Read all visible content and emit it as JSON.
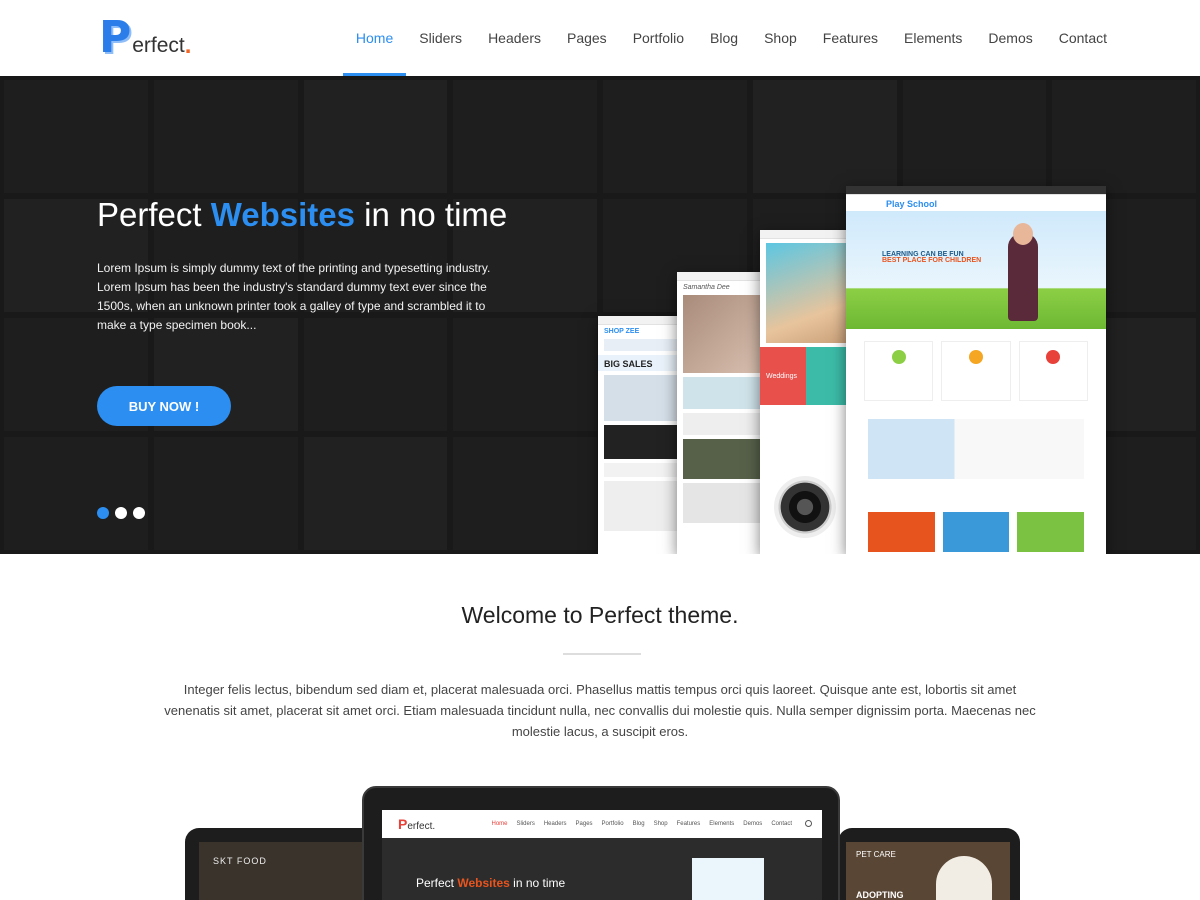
{
  "brand": {
    "logo_letter": "P",
    "logo_rest": "erfect",
    "logo_dot": ".",
    "accent_color": "#2b8ef0"
  },
  "nav": {
    "items": [
      {
        "label": "Home",
        "active": true
      },
      {
        "label": "Sliders"
      },
      {
        "label": "Headers"
      },
      {
        "label": "Pages"
      },
      {
        "label": "Portfolio"
      },
      {
        "label": "Blog"
      },
      {
        "label": "Shop"
      },
      {
        "label": "Features"
      },
      {
        "label": "Elements"
      },
      {
        "label": "Demos"
      },
      {
        "label": "Contact"
      }
    ]
  },
  "hero": {
    "title_before": "Perfect ",
    "title_accent": "Websites",
    "title_after": " in no time",
    "text": "Lorem Ipsum is simply dummy text of the printing and typesetting industry. Lorem Ipsum has been the industry's standard dummy text ever since the 1500s, when an unknown printer took a galley of type and scrambled it to make a type specimen book...",
    "button_label": "BUY NOW !",
    "slide_count": 3,
    "active_slide": 1,
    "mockups": {
      "shop_title": "BIG SALES",
      "shop_sub": "SHOP ZEE",
      "blog_title": "Samantha Dee",
      "photo_title": "Weddings",
      "school_title": "Play School",
      "school_headline": "LEARNING CAN BE FUN",
      "school_sub": "BEST PLACE FOR CHILDREN"
    }
  },
  "welcome": {
    "title": "Welcome to Perfect theme.",
    "text": "Integer felis lectus, bibendum sed diam et, placerat malesuada orci. Phasellus mattis tempus orci quis laoreet. Quisque ante est, lobortis sit amet venenatis sit amet, placerat sit amet orci. Etiam malesuada tincidunt nulla, nec convallis dui molestie quis. Nulla semper dignissim porta. Maecenas nec molestie lacus, a suscipit eros."
  },
  "showcase": {
    "left_brand": "SKT FOOD",
    "right_brand": "PET CARE",
    "right_title": "ADOPTING",
    "center_logo_letter": "P",
    "center_logo_rest": "erfect.",
    "center_nav": [
      "Home",
      "Sliders",
      "Headers",
      "Pages",
      "Portfolio",
      "Blog",
      "Shop",
      "Features",
      "Elements",
      "Demos",
      "Contact"
    ],
    "center_title_before": "Perfect ",
    "center_title_accent": "Websites",
    "center_title_after": " in no time"
  }
}
